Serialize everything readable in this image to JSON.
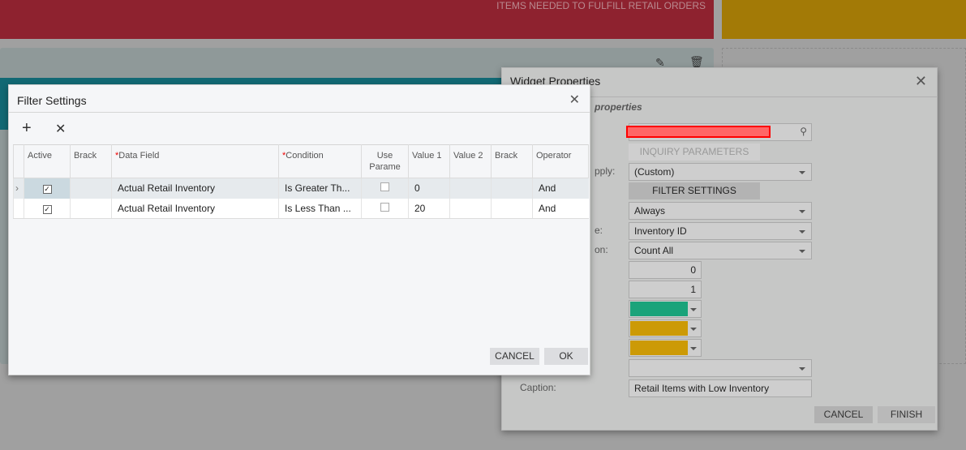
{
  "background": {
    "tile_red_text": "ITEMS NEEDED TO FULFILL RETAIL ORDERS",
    "colors": {
      "red": "#8e222f",
      "gold": "#a37a06",
      "teal": "#126974"
    }
  },
  "widget_properties": {
    "title": "Widget Properties",
    "section_label": "properties",
    "labels": {
      "apply": "pply:",
      "type": "e:",
      "aggregation": "on:",
      "caption": "Caption:"
    },
    "inquiry_parameters_label": "INQUIRY PARAMETERS",
    "shared_filter": "(Custom)",
    "filter_settings_label": "FILTER SETTINGS",
    "display_mode": "Always",
    "field": "Inventory ID",
    "aggregate": "Count All",
    "threshold_1": "0",
    "threshold_2": "1",
    "color_1": "#1aa37a",
    "color_2": "#cc9a06",
    "color_3": "#cc9a06",
    "empty_select": "",
    "caption": "Retail Items with Low Inventory",
    "cancel_label": "CANCEL",
    "finish_label": "FINISH"
  },
  "filter_settings": {
    "title": "Filter Settings",
    "columns": [
      "Active",
      "Brack",
      "Data Field",
      "Condition",
      "Use Parame",
      "Value 1",
      "Value 2",
      "Brack",
      "Operator"
    ],
    "rows": [
      {
        "active": true,
        "bracket_open": "",
        "data_field": "Actual Retail Inventory",
        "condition": "Is Greater Th...",
        "use_param": false,
        "value1": "0",
        "value2": "",
        "bracket_close": "",
        "operator": "And"
      },
      {
        "active": true,
        "bracket_open": "",
        "data_field": "Actual Retail Inventory",
        "condition": "Is Less Than ...",
        "use_param": false,
        "value1": "20",
        "value2": "",
        "bracket_close": "",
        "operator": "And"
      }
    ],
    "cancel_label": "CANCEL",
    "ok_label": "OK"
  }
}
